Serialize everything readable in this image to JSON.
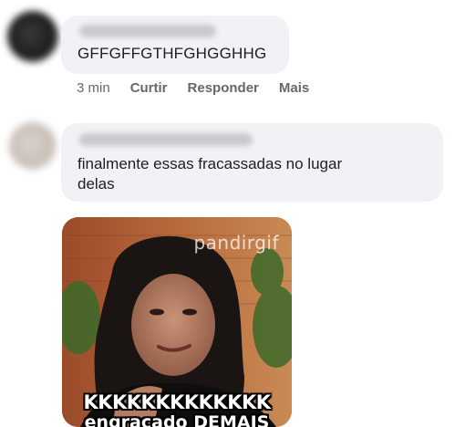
{
  "comments": [
    {
      "author_blurred": true,
      "text": "GFFGFFGTHFGHGGHHG",
      "meta": {
        "time": "3 min",
        "like_label": "Curtir",
        "reply_label": "Responder",
        "more_label": "Mais"
      }
    },
    {
      "author_blurred": true,
      "text": "finalmente essas fracassadas no lugar\ndelas",
      "attachment": {
        "type": "gif",
        "watermark": "pandirgif",
        "caption_line_1": "KKKKKKKKKKKKK",
        "caption_line_2": "engraçado DEMAIS"
      }
    }
  ],
  "colors": {
    "bubble_bg": "#f0f2f5",
    "meta_text": "#65676b",
    "body_text": "#1c1e21"
  }
}
